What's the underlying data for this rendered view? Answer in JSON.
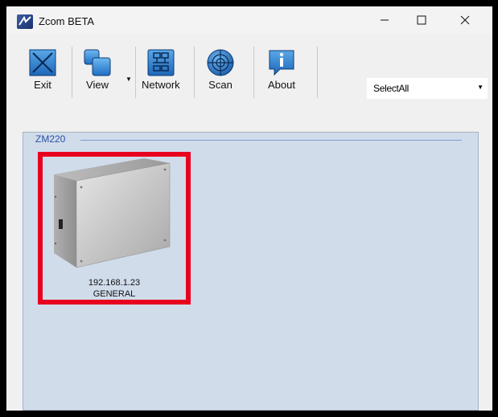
{
  "window": {
    "title": "Zcom BETA",
    "icons": {
      "app": "zcom-logo-icon",
      "minimize": "minimize-icon",
      "maximize": "maximize-icon",
      "close": "close-icon"
    }
  },
  "toolbar": {
    "exit_label": "Exit",
    "view_label": "View",
    "network_label": "Network",
    "scan_label": "Scan",
    "about_label": "About",
    "icons": {
      "exit": "exit-icon",
      "view": "view-icon",
      "network": "network-icon",
      "scan": "scan-radar-icon",
      "about": "info-icon"
    }
  },
  "selection": {
    "value": "SelectAll"
  },
  "group": {
    "title": "ZM220",
    "devices": [
      {
        "ip": "192.168.1.23",
        "name": "GENERAL",
        "selected": true
      }
    ]
  },
  "colors": {
    "selection_border": "#e8001e",
    "group_background": "#d0dcea",
    "group_title": "#2b4fa6"
  }
}
